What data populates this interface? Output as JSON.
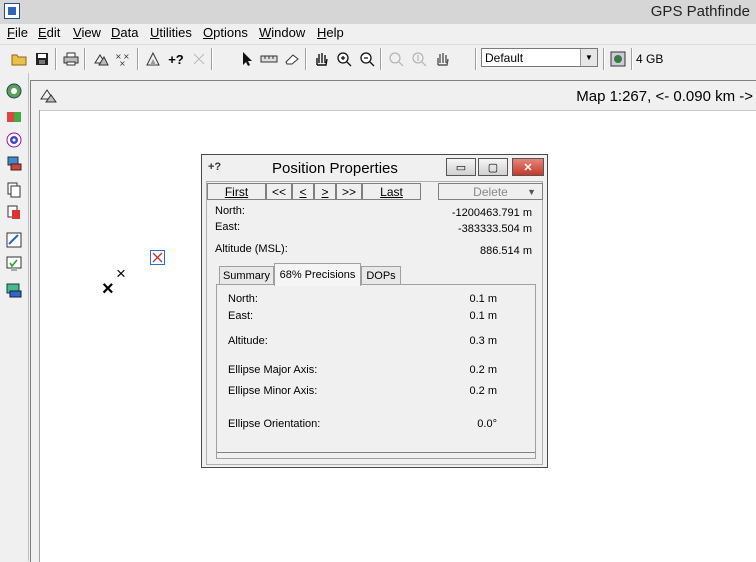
{
  "app": {
    "title": "GPS Pathfinde"
  },
  "menu": [
    {
      "label": "File",
      "u": "F"
    },
    {
      "label": "Edit",
      "u": "E"
    },
    {
      "label": "View",
      "u": "V"
    },
    {
      "label": "Data",
      "u": "D"
    },
    {
      "label": "Utilities",
      "u": "U"
    },
    {
      "label": "Options",
      "u": "O"
    },
    {
      "label": "Window",
      "u": "W"
    },
    {
      "label": "Help",
      "u": "H"
    }
  ],
  "toolbar": {
    "layer_select": "Default",
    "memory": "4 GB",
    "add_position_label": "+?"
  },
  "map": {
    "scale": "Map 1:267, <- 0.090 km ->"
  },
  "dialog": {
    "title": "Position Properties",
    "icon_label": "+?",
    "nav": {
      "first": "First",
      "prev_page": "<<",
      "prev": "<",
      "next": ">",
      "next_page": ">>",
      "last": "Last",
      "delete": "Delete"
    },
    "north_label": "North:",
    "north_value": "-1200463.791 m",
    "east_label": "East:",
    "east_value": "-383333.504 m",
    "altitude_label": "Altitude (MSL):",
    "altitude_value": "886.514 m",
    "tabs": [
      "Summary",
      "68% Precisions",
      "DOPs"
    ],
    "precisions": {
      "north_label": "North:",
      "north_value": "0.1 m",
      "east_label": "East:",
      "east_value": "0.1 m",
      "altitude_label": "Altitude:",
      "altitude_value": "0.3 m",
      "major_label": "Ellipse Major Axis:",
      "major_value": "0.2 m",
      "minor_label": "Ellipse Minor Axis:",
      "minor_value": "0.2 m",
      "orient_label": "Ellipse Orientation:",
      "orient_value": "0.0°"
    }
  }
}
